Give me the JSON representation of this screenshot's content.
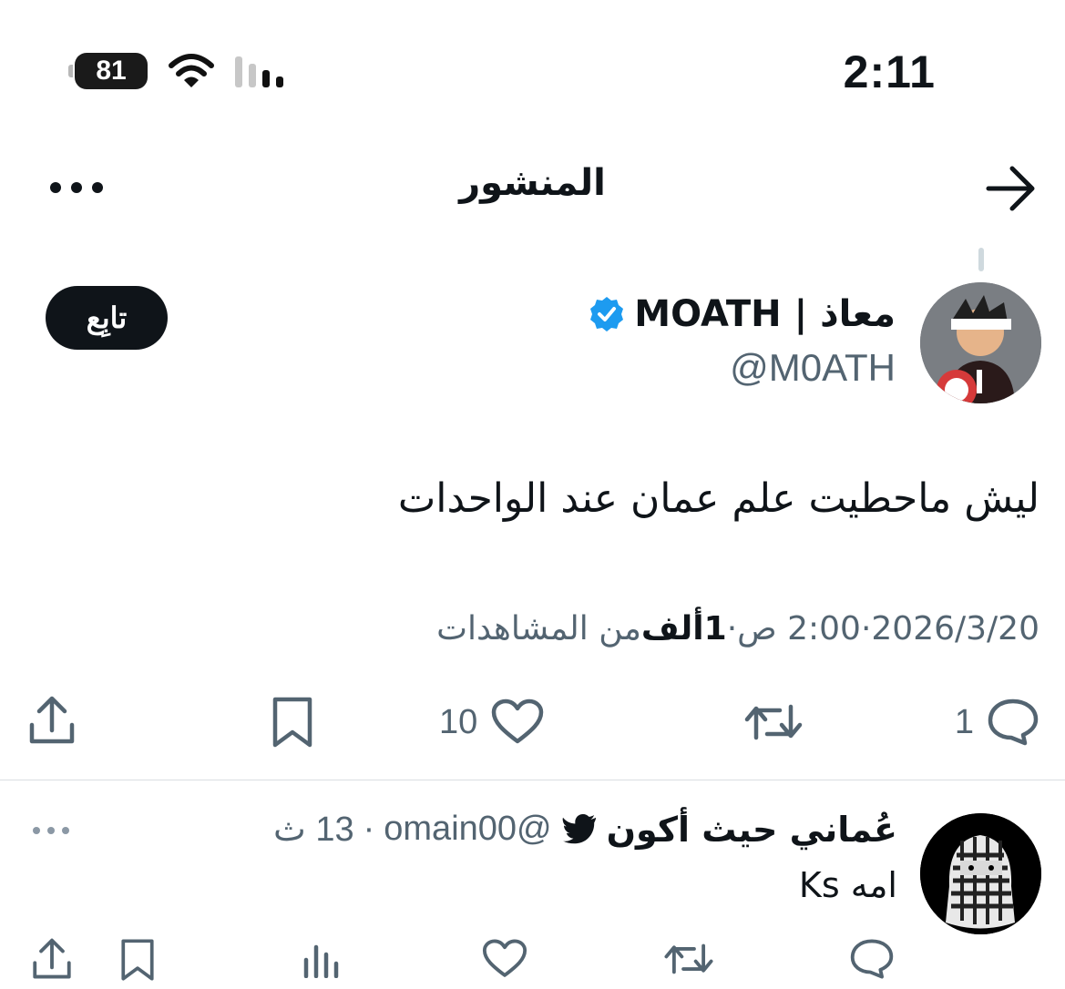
{
  "status_bar": {
    "battery": "81",
    "time": "2:11"
  },
  "header": {
    "title": "المنشور"
  },
  "post": {
    "display_name": "معاذ | MOATH",
    "handle": "@M0ATH",
    "follow_label": "تابِع",
    "text": "ليش ماحطيت علم عمان عند الواحدات",
    "meta": {
      "date": "2026/3/20",
      "sep1": " · ",
      "time": "2:00 ص",
      "sep2": " · ",
      "views_count": "1ألف",
      "views_label": " من المشاهدات"
    },
    "actions": {
      "replies": "1",
      "likes": "10"
    }
  },
  "reply": {
    "display_name": "عُماني حيث أكون",
    "handle": "@omain00",
    "dot": "·",
    "time": "13 ث",
    "text": "امه Ks"
  },
  "colors": {
    "text": "#0f1419",
    "muted": "#536471",
    "verified": "#1d9bf0"
  }
}
